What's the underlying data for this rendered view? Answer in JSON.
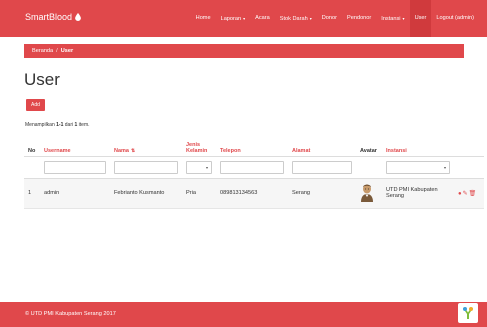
{
  "navbar": {
    "brand": "SmartBlood",
    "items": [
      {
        "label": "Home",
        "caret": ""
      },
      {
        "label": "Laporan",
        "caret": "▾"
      },
      {
        "label": "Acara",
        "caret": ""
      },
      {
        "label": "Stok Darah",
        "caret": "▾"
      },
      {
        "label": "Donor",
        "caret": ""
      },
      {
        "label": "Pendonor",
        "caret": ""
      },
      {
        "label": "Instansi",
        "caret": "▾"
      },
      {
        "label": "User",
        "caret": ""
      },
      {
        "label": "Logout (admin)",
        "caret": ""
      }
    ],
    "active": "User"
  },
  "breadcrumb": {
    "home": "Beranda",
    "separator": "/",
    "current": "User"
  },
  "page": {
    "title": "User",
    "add_label": "Add",
    "summary_prefix": "Menampilkan",
    "summary_range": "1-1",
    "summary_mid": "dari",
    "summary_total": "1",
    "summary_suffix": "item."
  },
  "table": {
    "headers": [
      "No",
      "Username",
      "Nama",
      "Jenis Kelamin",
      "Telepon",
      "Alamat",
      "Avatar",
      "Instansi"
    ],
    "sort_icon": "⇅",
    "rows": [
      {
        "no": "1",
        "username": "admin",
        "nama": "Febrianto Kusmanto",
        "jenis_kelamin": "Pria",
        "telepon": "089813134563",
        "alamat": "Serang",
        "instansi": "UTD PMI Kabupaten Serang"
      }
    ]
  },
  "footer": {
    "text": "© UTD PMI Kabupaten Serang 2017"
  },
  "icons": {
    "view": "eye-icon",
    "edit": "pencil-icon",
    "delete": "trash-icon",
    "brand": "blood-drop-icon",
    "footer_logo": "yii-logo-icon"
  },
  "colors": {
    "primary": "#e0484b",
    "active_nav": "#d03a3d",
    "footer": "#e0484b"
  }
}
